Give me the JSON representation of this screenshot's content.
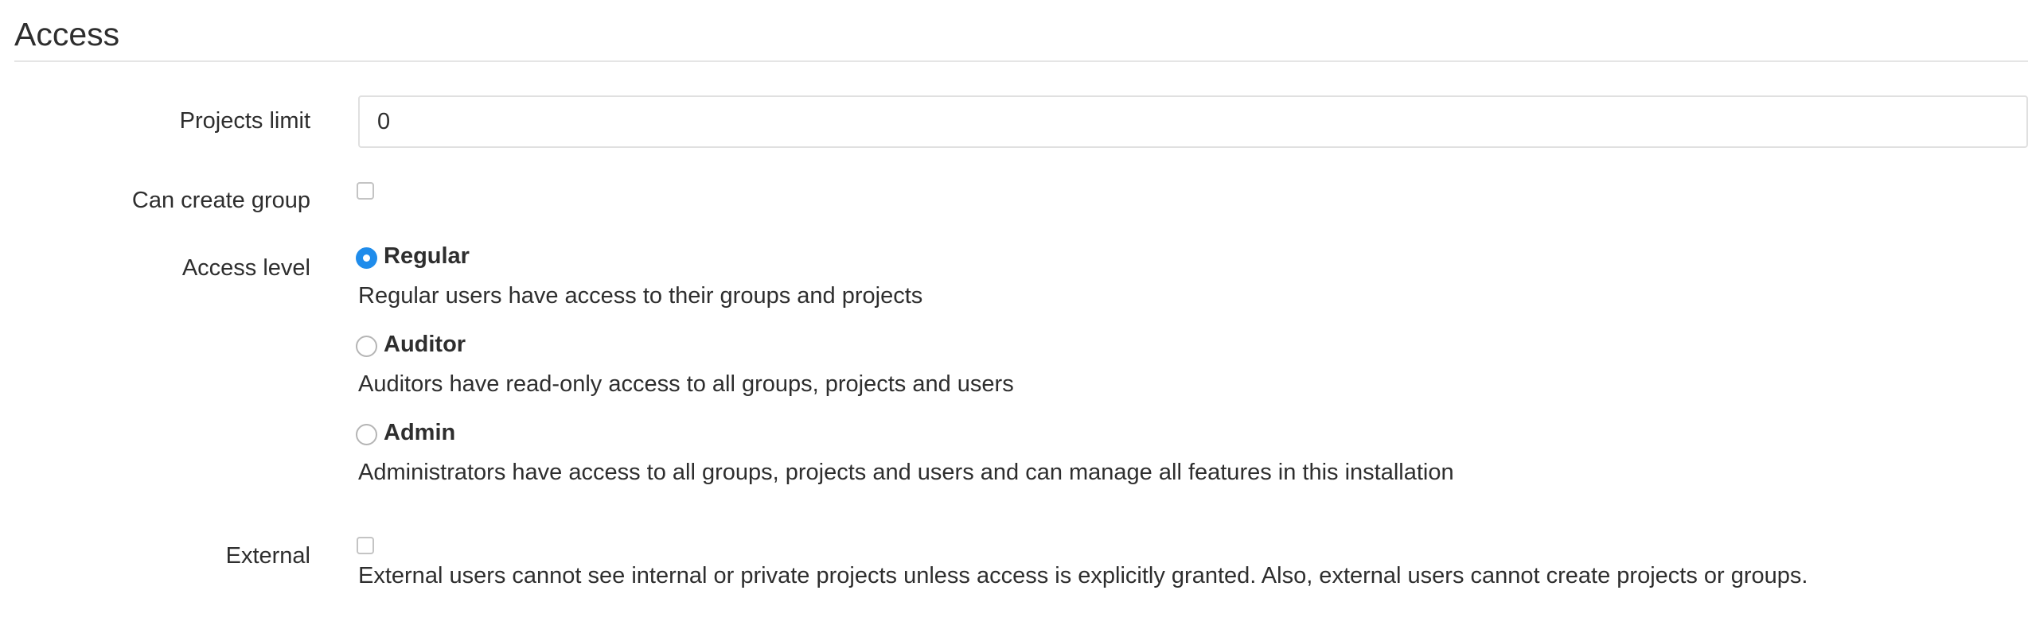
{
  "section": {
    "title": "Access"
  },
  "projects_limit": {
    "label": "Projects limit",
    "value": "0"
  },
  "can_create_group": {
    "label": "Can create group",
    "checked": false
  },
  "access_level": {
    "label": "Access level",
    "selected": "Regular",
    "options": [
      {
        "label": "Regular",
        "description": "Regular users have access to their groups and projects",
        "checked": true
      },
      {
        "label": "Auditor",
        "description": "Auditors have read-only access to all groups, projects and users",
        "checked": false
      },
      {
        "label": "Admin",
        "description": "Administrators have access to all groups, projects and users and can manage all features in this installation",
        "checked": false
      }
    ]
  },
  "external": {
    "label": "External",
    "checked": false,
    "description": "External users cannot see internal or private projects unless access is explicitly granted. Also, external users cannot create projects or groups."
  },
  "colors": {
    "accent": "#1f8ceb",
    "text": "#2e2e2e",
    "border": "#e0e0e0"
  }
}
